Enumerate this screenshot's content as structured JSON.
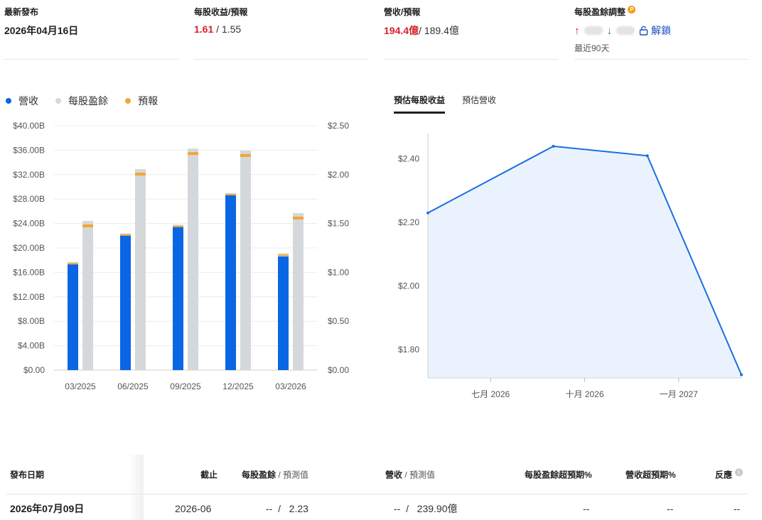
{
  "stats": {
    "latest": {
      "label": "最新發布",
      "value": "2026年04月16日"
    },
    "eps": {
      "label": "每股收益/預報",
      "actual": "1.61",
      "forecast": "/ 1.55"
    },
    "revenue": {
      "label": "營收/預報",
      "actual": "194.4億",
      "forecast": "/ 189.4億"
    },
    "revision": {
      "label": "每股盈餘調整",
      "badge": "P",
      "unlock_label": "解鎖",
      "period": "最近90天",
      "up_icon": "arrow-up-icon",
      "down_icon": "arrow-down-icon",
      "lock_icon": "lock-icon"
    }
  },
  "legend": [
    {
      "label": "營收",
      "color": "#0a66e4"
    },
    {
      "label": "每股盈餘",
      "color": "#d5d8db"
    },
    {
      "label": "預報",
      "color": "#f0a733"
    }
  ],
  "tabs": [
    {
      "label": "預估每股收益",
      "active": true
    },
    {
      "label": "預估營收",
      "active": false
    }
  ],
  "chart_data": [
    {
      "type": "bar",
      "categories": [
        "03/2025",
        "06/2025",
        "09/2025",
        "12/2025",
        "03/2026"
      ],
      "left_axis_ticks": [
        "$0.00",
        "$4.00B",
        "$8.00B",
        "$12.00B",
        "$16.00B",
        "$20.00B",
        "$24.00B",
        "$28.00B",
        "$32.00B",
        "$36.00B",
        "$40.00B"
      ],
      "right_axis_ticks": [
        "$0.00",
        "$0.50",
        "$1.00",
        "$1.50",
        "$2.00",
        "$2.50"
      ],
      "ylim_left": [
        0,
        40
      ],
      "ylim_right": [
        0,
        2.5
      ],
      "series": [
        {
          "name": "營收",
          "axis": "left",
          "values": [
            17.4,
            22.0,
            23.6,
            28.7,
            18.6
          ],
          "forecast": [
            17.7,
            22.4,
            23.8,
            29.0,
            19.1
          ],
          "color": "#0a66e4"
        },
        {
          "name": "每股盈餘",
          "axis": "right",
          "values": [
            1.46,
            1.99,
            2.21,
            2.19,
            1.54
          ],
          "forecast": [
            1.49,
            2.02,
            2.23,
            2.21,
            1.57
          ],
          "color": "#d5d8db"
        }
      ],
      "forecast_color": "#f0a733",
      "grid": true,
      "legend_placement": "top-left"
    },
    {
      "type": "area",
      "x": [
        "2026-05",
        "2026-09",
        "2026-12",
        "2027-03"
      ],
      "values": [
        2.23,
        2.44,
        2.41,
        1.72
      ],
      "x_ticks": [
        "七月 2026",
        "十月 2026",
        "一月 2027"
      ],
      "y_ticks": [
        "$1.80",
        "$2.00",
        "$2.20",
        "$2.40"
      ],
      "ylim": [
        1.71,
        2.48
      ],
      "color": "#1a6fe0",
      "fill": "#eaf3fd"
    }
  ],
  "table": {
    "headers": {
      "date": "發布日期",
      "period": "截止",
      "eps": "每股盈餘",
      "eps_sep": "/",
      "eps_fc": "預測值",
      "rev": "營收",
      "rev_sep": "/",
      "rev_fc": "預測值",
      "eps_surprise": "每股盈餘超預期%",
      "rev_surprise": "營收超預期%",
      "reaction": "反應"
    },
    "rows": [
      {
        "date": "2026年07月09日",
        "period": "2026-06",
        "eps": "--  /   2.23",
        "rev": "--  /   239.90億",
        "eps_surprise": "--",
        "rev_surprise": "--",
        "reaction": "--"
      }
    ]
  }
}
